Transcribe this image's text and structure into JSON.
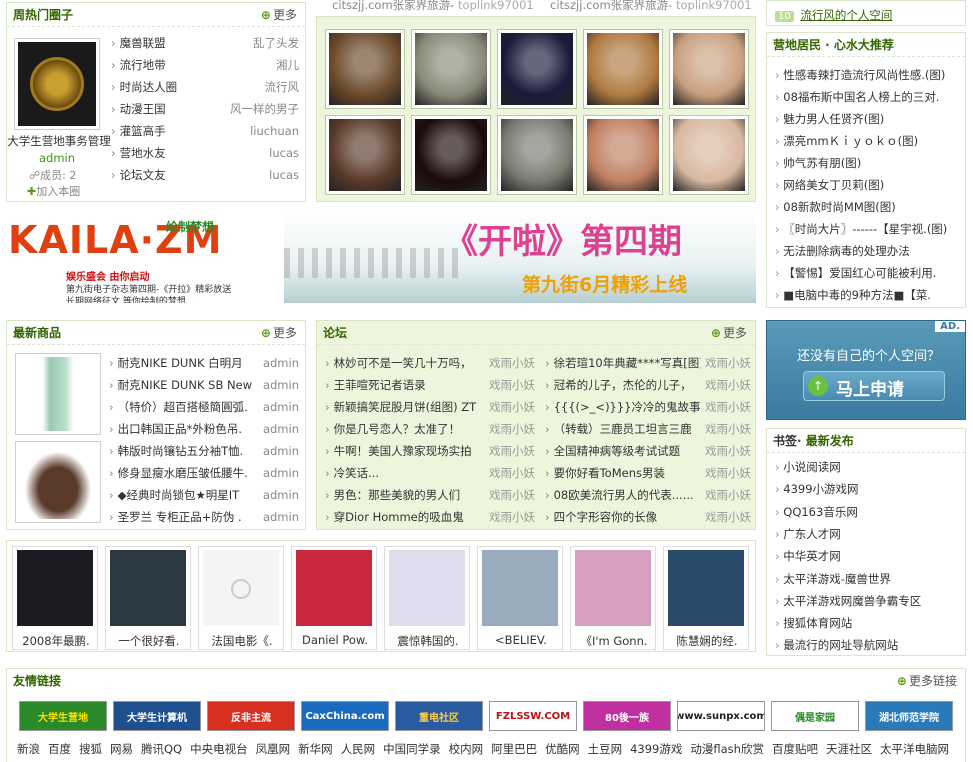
{
  "hot_circles": {
    "title": "周热门圈子",
    "more": "更多",
    "featured_name": "大学生营地事务管理",
    "featured_admin": "admin",
    "featured_members": "成员: 2",
    "join": "加入本圈",
    "items": [
      {
        "name": "魔兽联盟",
        "owner": "乱了头发"
      },
      {
        "name": "流行地带",
        "owner": "湘儿"
      },
      {
        "name": "时尚达人圈",
        "owner": "流行风"
      },
      {
        "name": "动漫王国",
        "owner": "风一样的男子"
      },
      {
        "name": "灌篮高手",
        "owner": "liuchuan"
      },
      {
        "name": "营地水友",
        "owner": "lucas"
      },
      {
        "name": "论坛文友",
        "owner": "lucas"
      }
    ]
  },
  "top_links": [
    {
      "text": "citszjj.com张家界旅游-",
      "src": "toplink97001"
    },
    {
      "text": "citszjj.com张家界旅游-",
      "src": "toplink97001"
    }
  ],
  "photo_grid": {
    "row1": [
      "#6b4a2a",
      "#8a8a7a",
      "#1a1a3a",
      "#b07a40",
      "#c9a080"
    ],
    "row2": [
      "#5a3a2a",
      "#1a0a0a",
      "#7a7a70",
      "#c08060",
      "#d8b8a0"
    ]
  },
  "banner": {
    "left_brand": "KAILA·ZM",
    "left_tag": "绘制梦想",
    "left_line1": "娱乐盛会 由你启动",
    "left_line2": "第九街电子杂志第四期-《开拉》精彩放送",
    "left_line3": "长期网络征文 等你绘制的梦想...",
    "right_title": "《开啦》第四期",
    "right_sub": "第九街6月精彩上线"
  },
  "right_top": {
    "badge": "10",
    "text": "流行风的个人空间"
  },
  "camp_recommend": {
    "title": "营地居民 · 心水大推荐",
    "items": [
      "性感毒辣打造流行风尚性感.(图)",
      "08福布斯中国名人榜上的三对.",
      "魅力男人任贤齐(图)",
      "漂亮mmＫｉｙｏｋｏ(图)",
      "帅气苏有朋(图)",
      "网络美女丁贝莉(图)",
      "08新款时尚MM图(图)",
      "〖时尚大片〗------【星宇视.(图)",
      "无法删除病毒的处理办法",
      "【警惕】爱国红心可能被利用.",
      "■电脑中毒的9种方法■【菜."
    ]
  },
  "products": {
    "title": "最新商品",
    "more": "更多",
    "items": [
      {
        "name": "耐克NIKE DUNK 白明月",
        "by": "admin"
      },
      {
        "name": "耐克NIKE DUNK SB New",
        "by": "admin"
      },
      {
        "name": "（特价）超百搭極簡圓弧.",
        "by": "admin"
      },
      {
        "name": "出口韩国正品*外粉色吊.",
        "by": "admin"
      },
      {
        "name": "韩版时尚镶钻五分袖T恤.",
        "by": "admin"
      },
      {
        "name": "修身显瘦水磨压皱低腰牛.",
        "by": "admin"
      },
      {
        "name": "◆经典时尚锁包★明星IT",
        "by": "admin"
      },
      {
        "name": "圣罗兰 专柜正品+防伪 .",
        "by": "admin"
      }
    ]
  },
  "forum": {
    "title": "论坛",
    "more": "更多",
    "left": [
      {
        "t": "林妙可不是一笑几十万吗，",
        "u": "戏雨小妖"
      },
      {
        "t": "王菲喧死记者语录",
        "u": "戏雨小妖"
      },
      {
        "t": "新颖搞笑屁股月饼(组图) ZT",
        "u": "戏雨小妖"
      },
      {
        "t": "你是几号恋人？太准了！",
        "u": "戏雨小妖"
      },
      {
        "t": "牛啊！美国人豫家现场实拍",
        "u": "戏雨小妖"
      },
      {
        "t": "冷笑话...",
        "u": "戏雨小妖"
      },
      {
        "t": "男色：那些美貌的男人们",
        "u": "戏雨小妖"
      },
      {
        "t": "穿Dior Homme的吸血鬼",
        "u": "戏雨小妖"
      }
    ],
    "right": [
      {
        "t": "徐若瑄10年典藏****写真[图]",
        "u": "戏雨小妖"
      },
      {
        "t": "冠希的儿子，杰伦的儿子，",
        "u": "戏雨小妖"
      },
      {
        "t": "{{{(>_<)}}}冷冷的鬼故事",
        "u": "戏雨小妖"
      },
      {
        "t": "（转载）三鹿员工坦言三鹿",
        "u": "戏雨小妖"
      },
      {
        "t": "全国精神病等级考试试题",
        "u": "戏雨小妖"
      },
      {
        "t": "要你好看ToMens男装",
        "u": "戏雨小妖"
      },
      {
        "t": "08欧美流行男人的代表......",
        "u": "戏雨小妖"
      },
      {
        "t": "四个字形容你的长像",
        "u": "戏雨小妖"
      }
    ]
  },
  "ad_box": {
    "ad": "AD.",
    "question": "还没有自己的个人空间？",
    "cta": "马上申请"
  },
  "bookmarks": {
    "title_a": "书签",
    "title_b": "· 最新发布",
    "items": [
      "小说阅读网",
      "4399小游戏网",
      "QQ163音乐网",
      "广东人才网",
      "中华英才网",
      "太平洋游戏-魔兽世界",
      "太平洋游戏网魔兽争霸专区",
      "搜狐体育网站",
      "最流行的网址导航网站"
    ]
  },
  "videos": [
    {
      "label": "2008年最鹏.",
      "color": "#1b1b22"
    },
    {
      "label": "一个很好看.",
      "color": "#2a3a40"
    },
    {
      "label": "法国电影《.",
      "color": "#f4f4f4"
    },
    {
      "label": "Daniel Pow.",
      "color": "#c8283c"
    },
    {
      "label": "震惊韩国的.",
      "color": "#dde"
    },
    {
      "label": "<BELIEV.",
      "color": "#9ab"
    },
    {
      "label": "《I'm Gonn.",
      "color": "#d8a0c0"
    },
    {
      "label": "陈慧娴的经.",
      "color": "#2a4a6a"
    }
  ],
  "friend_links": {
    "title": "友情链接",
    "more": "更多链接",
    "logos": [
      {
        "text": "大学生营地",
        "bg": "#2a8a2a",
        "fg": "#ffe000"
      },
      {
        "text": "大学生计算机",
        "bg": "#1f4f8f",
        "fg": "#ffffff"
      },
      {
        "text": "反非主流",
        "bg": "#d83020",
        "fg": "#ffffff"
      },
      {
        "text": "CaxChina.com",
        "bg": "#1a6abf",
        "fg": "#ffffff"
      },
      {
        "text": "重电社区",
        "bg": "#2a5aa0",
        "fg": "#ffd040"
      },
      {
        "text": "FZLSSW.COM",
        "bg": "#ffffff",
        "fg": "#c01010"
      },
      {
        "text": "80後一族",
        "bg": "#c030a0",
        "fg": "#ffffff"
      },
      {
        "text": "www.sunpx.com",
        "bg": "#ffffff",
        "fg": "#222222"
      },
      {
        "text": "偶是家园",
        "bg": "#ffffff",
        "fg": "#2a8a2a"
      },
      {
        "text": "湖北师范学院",
        "bg": "#2a7aba",
        "fg": "#ffffff"
      }
    ],
    "text_links": [
      "新浪",
      "百度",
      "搜狐",
      "网易",
      "腾讯QQ",
      "中央电视台",
      "凤凰网",
      "新华网",
      "人民网",
      "中国同学录",
      "校内网",
      "阿里巴巴",
      "优酷网",
      "土豆网",
      "4399游戏",
      "动漫flash欣赏",
      "百度贴吧",
      "天涯社区",
      "太平洋电脑网"
    ]
  }
}
